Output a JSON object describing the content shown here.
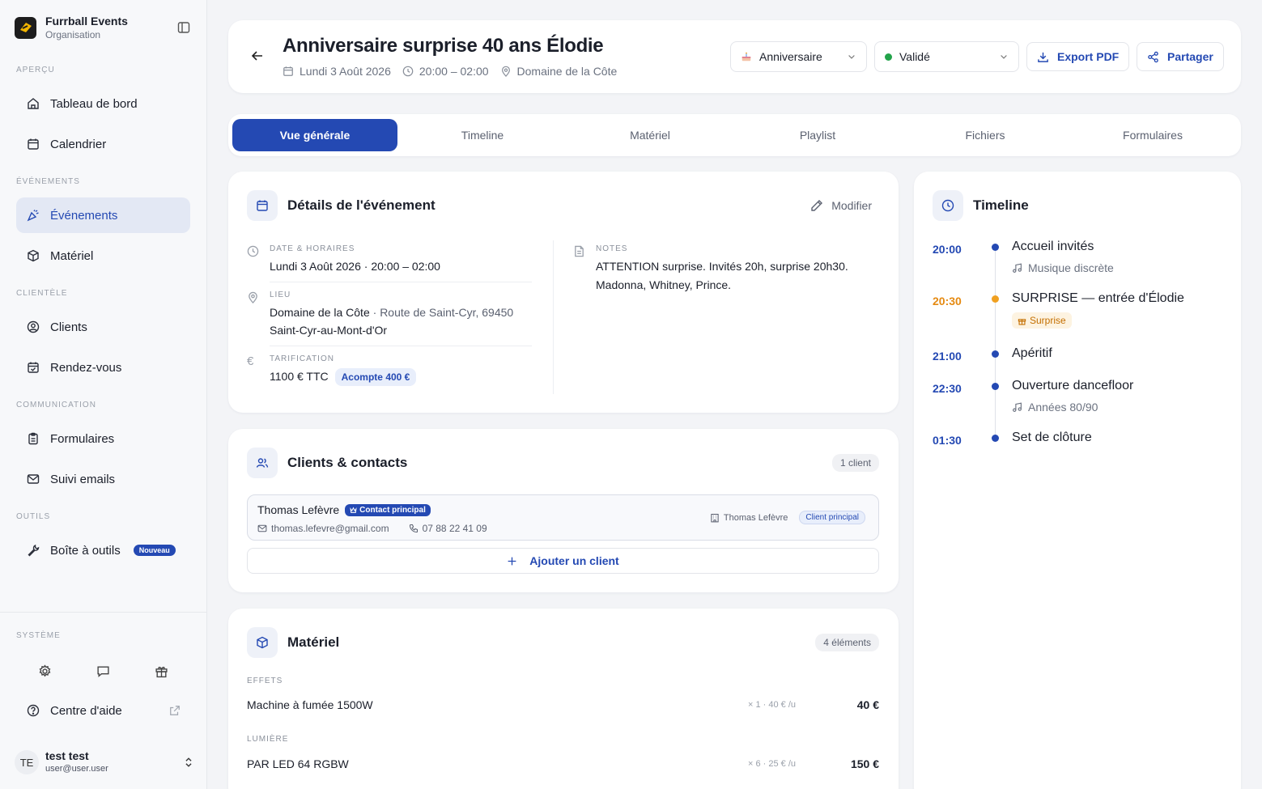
{
  "org": {
    "name": "Furrball Events",
    "subtitle": "Organisation"
  },
  "sidebar": {
    "sections": [
      "Aperçu",
      "Événements",
      "Clientèle",
      "Communication",
      "Outils",
      "Système"
    ],
    "items": [
      {
        "label": "Tableau de bord",
        "icon": "home-icon"
      },
      {
        "label": "Calendrier",
        "icon": "calendar-icon"
      },
      {
        "label": "Événements",
        "icon": "party-icon"
      },
      {
        "label": "Matériel",
        "icon": "box-icon"
      },
      {
        "label": "Clients",
        "icon": "user-circle-icon"
      },
      {
        "label": "Rendez-vous",
        "icon": "calendar-check-icon"
      },
      {
        "label": "Formulaires",
        "icon": "clipboard-icon"
      },
      {
        "label": "Suivi emails",
        "icon": "mail-icon"
      },
      {
        "label": "Boîte à outils",
        "icon": "wrench-icon",
        "badge": "Nouveau"
      }
    ],
    "help": "Centre d'aide",
    "active_color": "#2449b3"
  },
  "user": {
    "initials": "TE",
    "name": "test test",
    "email": "user@user.user"
  },
  "header": {
    "title": "Anniversaire surprise 40 ans Élodie",
    "date": "Lundi 3 Août 2026",
    "time": "20:00 – 02:00",
    "location": "Domaine de la Côte",
    "type_select": "Anniversaire",
    "status_select": "Validé",
    "status_color": "#22a34a",
    "export_label": "Export PDF",
    "share_label": "Partager"
  },
  "tabs": [
    "Vue générale",
    "Timeline",
    "Matériel",
    "Playlist",
    "Fichiers",
    "Formulaires"
  ],
  "details": {
    "title": "Détails de l'événement",
    "modify_label": "Modifier",
    "date_label": "Date & horaires",
    "date_value": "Lundi 3 Août 2026 · 20:00 – 02:00",
    "place_label": "Lieu",
    "place_name": "Domaine de la Côte",
    "place_address": " · Route de Saint-Cyr, 69450",
    "place_city": "Saint-Cyr-au-Mont-d'Or",
    "pricing_label": "Tarification",
    "price": "1100 € TTC",
    "deposit": "Acompte 400 €",
    "notes_label": "Notes",
    "notes_line1": "ATTENTION surprise. Invités 20h, surprise 20h30.",
    "notes_line2": "Madonna, Whitney, Prince."
  },
  "clients": {
    "title": "Clients & contacts",
    "count": "1 client",
    "name": "Thomas Lefèvre",
    "contact_badge": "Contact principal",
    "email": "thomas.lefevre@gmail.com",
    "phone": "07 88 22 41 09",
    "company": "Thomas Lefèvre",
    "client_badge": "Client principal",
    "add_label": "Ajouter un client"
  },
  "materiel": {
    "title": "Matériel",
    "count": "4 éléments",
    "groups": [
      {
        "category": "EFFETS",
        "item": "Machine à fumée 1500W",
        "qty": "× 1 · 40 € /u",
        "price": "40 €"
      },
      {
        "category": "LUMIÈRE",
        "item": "PAR LED 64 RGBW",
        "qty": "× 6 · 25 € /u",
        "price": "150 €"
      }
    ]
  },
  "timeline": {
    "title": "Timeline",
    "entries": [
      {
        "time": "20:00",
        "title": "Accueil invités",
        "sub": "Musique discrète"
      },
      {
        "time": "20:30",
        "title": "SURPRISE — entrée d'Élodie",
        "tag": "Surprise"
      },
      {
        "time": "21:00",
        "title": "Apéritif"
      },
      {
        "time": "22:30",
        "title": "Ouverture dancefloor",
        "sub": "Années 80/90"
      },
      {
        "time": "01:30",
        "title": "Set de clôture"
      }
    ]
  }
}
